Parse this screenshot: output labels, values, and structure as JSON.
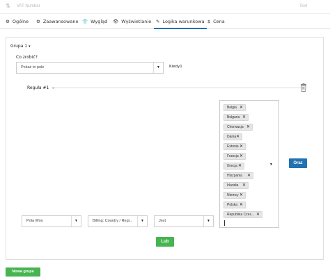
{
  "field_bar": {
    "name": "VAT Number",
    "type": "Text"
  },
  "tabs": [
    {
      "label": "Ogólne",
      "icon": "⚙"
    },
    {
      "label": "Zaawansowane",
      "icon": "⚙"
    },
    {
      "label": "Wygląd",
      "icon": "👕"
    },
    {
      "label": "Wyświetlanie",
      "icon": "👁"
    },
    {
      "label": "Logika warunkowa",
      "icon": "✎"
    },
    {
      "label": "Cena",
      "icon": "$"
    }
  ],
  "active_tab": "Logika warunkowa",
  "group": {
    "title": "Grupa 1",
    "action_label": "Co zrobić?",
    "action_value": "Pokaż to pole",
    "when_label": "Kiedy1",
    "rule_title": "Reguła #1",
    "field_select": "Pola Woo",
    "field_sub_select": "Billing: Country / Regi...",
    "operator_select": "Jest",
    "values": [
      "Belgia",
      "Bułgaria",
      "Chorwacja",
      "Dania",
      "Estonia",
      "Francja",
      "Grecja",
      "Hiszpania",
      "Irlandia",
      "Niemcy",
      "Polska",
      "Republika Czes..."
    ],
    "and_button": "Oraz",
    "or_button": "Lub"
  },
  "new_group_button": "Nowa grupa",
  "colors": {
    "accent": "#2271b1",
    "green": "#46b450",
    "border": "#dddddd"
  }
}
